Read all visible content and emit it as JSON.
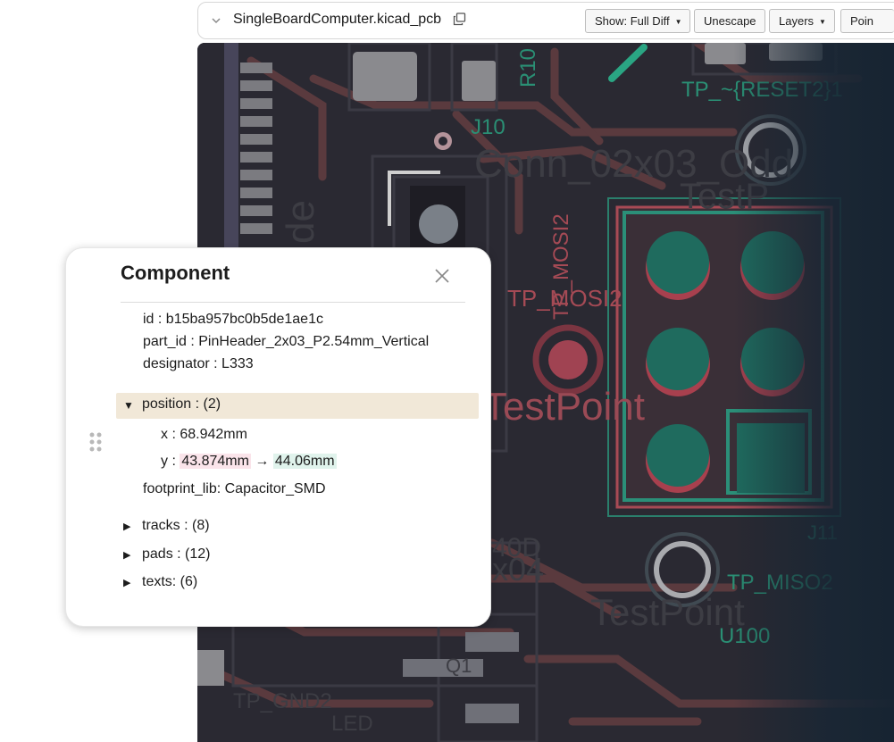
{
  "toolbar": {
    "filename": "SingleBoardComputer.kicad_pcb",
    "show_label": "Show: Full Diff",
    "unescape_label": "Unescape",
    "layers_label": "Layers",
    "points_label": "Poin"
  },
  "pcb_labels": {
    "r10": "R10",
    "j10": "J10",
    "tp_reset": "TP_~{RESET2}1",
    "conn": "Conn_02x03_Odd",
    "testpoint_ghost": "TestP",
    "tp_mosi_v": "TP_MOSI2",
    "tp_mosi_h": "TP_MOSI2",
    "testpoint": "TestPoint",
    "j11": "J11",
    "tp_miso": "TP_MISO2",
    "testpoint2": "TestPoint",
    "u100": "U100",
    "x04": "x04",
    "d_label": "40D",
    "q1": "Q1",
    "gnd": "TP_GND2",
    "led": "LED",
    "bg_ghost": "de"
  },
  "panel": {
    "title": "Component",
    "id_text": "id : b15ba957bc0b5de1ae1c",
    "part_id_text": "part_id : PinHeader_2x03_P2.54mm_Vertical",
    "designator_text": "designator : L333",
    "position_label": "position : (2)",
    "x_text": "x : 68.942mm",
    "y_label": "y :",
    "y_old": "43.874mm",
    "arrow": "→",
    "y_new": "44.06mm",
    "footprint_text": "footprint_lib: Capacitor_SMD",
    "tracks_label": "tracks : (8)",
    "pads_label": "pads : (12)",
    "texts_label": "texts: (6)"
  },
  "colors": {
    "board": "#2a2932",
    "track": "#5a3a3e",
    "pad_green": "#1f6b5e",
    "pad_red": "#a8404e",
    "silk_green": "#2e8f77",
    "silk_red": "#a54a55",
    "highlight": "#f1e8d8",
    "deleted_bg": "#fae4ea",
    "added_bg": "#e0f3ec"
  },
  "icons": {
    "collapse": "chevron-down-icon",
    "copy": "copy-icon",
    "close": "close-icon",
    "drag": "drag-handle-icon",
    "expanded": "triangle-down-icon",
    "collapsed": "triangle-right-icon"
  }
}
